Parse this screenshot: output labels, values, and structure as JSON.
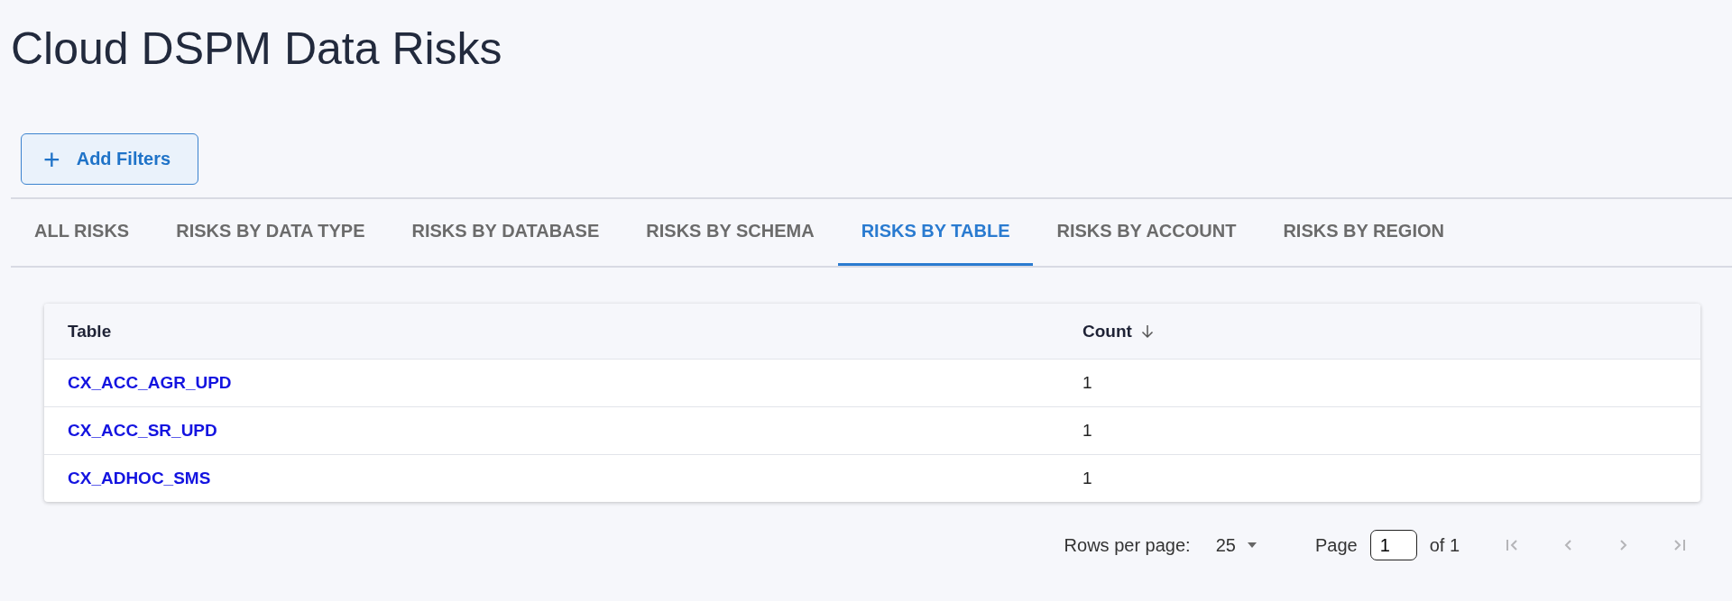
{
  "page": {
    "title": "Cloud DSPM Data Risks"
  },
  "filter_button": {
    "icon": "+",
    "label": "Add Filters"
  },
  "tabs": [
    {
      "label": "ALL RISKS",
      "selected": false
    },
    {
      "label": "RISKS BY DATA TYPE",
      "selected": false
    },
    {
      "label": "RISKS BY DATABASE",
      "selected": false
    },
    {
      "label": "RISKS BY SCHEMA",
      "selected": false
    },
    {
      "label": "RISKS BY TABLE",
      "selected": true
    },
    {
      "label": "RISKS BY ACCOUNT",
      "selected": false
    },
    {
      "label": "RISKS BY REGION",
      "selected": false
    }
  ],
  "table": {
    "columns": [
      {
        "label": "Table",
        "sorted": false
      },
      {
        "label": "Count",
        "sorted": true
      }
    ],
    "rows": [
      {
        "table": "CX_ACC_AGR_UPD",
        "count": "1"
      },
      {
        "table": "CX_ACC_SR_UPD",
        "count": "1"
      },
      {
        "table": "CX_ADHOC_SMS",
        "count": "1"
      }
    ]
  },
  "pagination": {
    "rows_per_page_label": "Rows per page:",
    "rows_per_page": "25",
    "page_label": "Page",
    "page": "1",
    "of_label": "of 1",
    "nav": [
      {
        "kind": "first",
        "disabled": true
      },
      {
        "kind": "prev",
        "disabled": true
      },
      {
        "kind": "next",
        "disabled": true
      },
      {
        "kind": "last",
        "disabled": true
      }
    ]
  }
}
